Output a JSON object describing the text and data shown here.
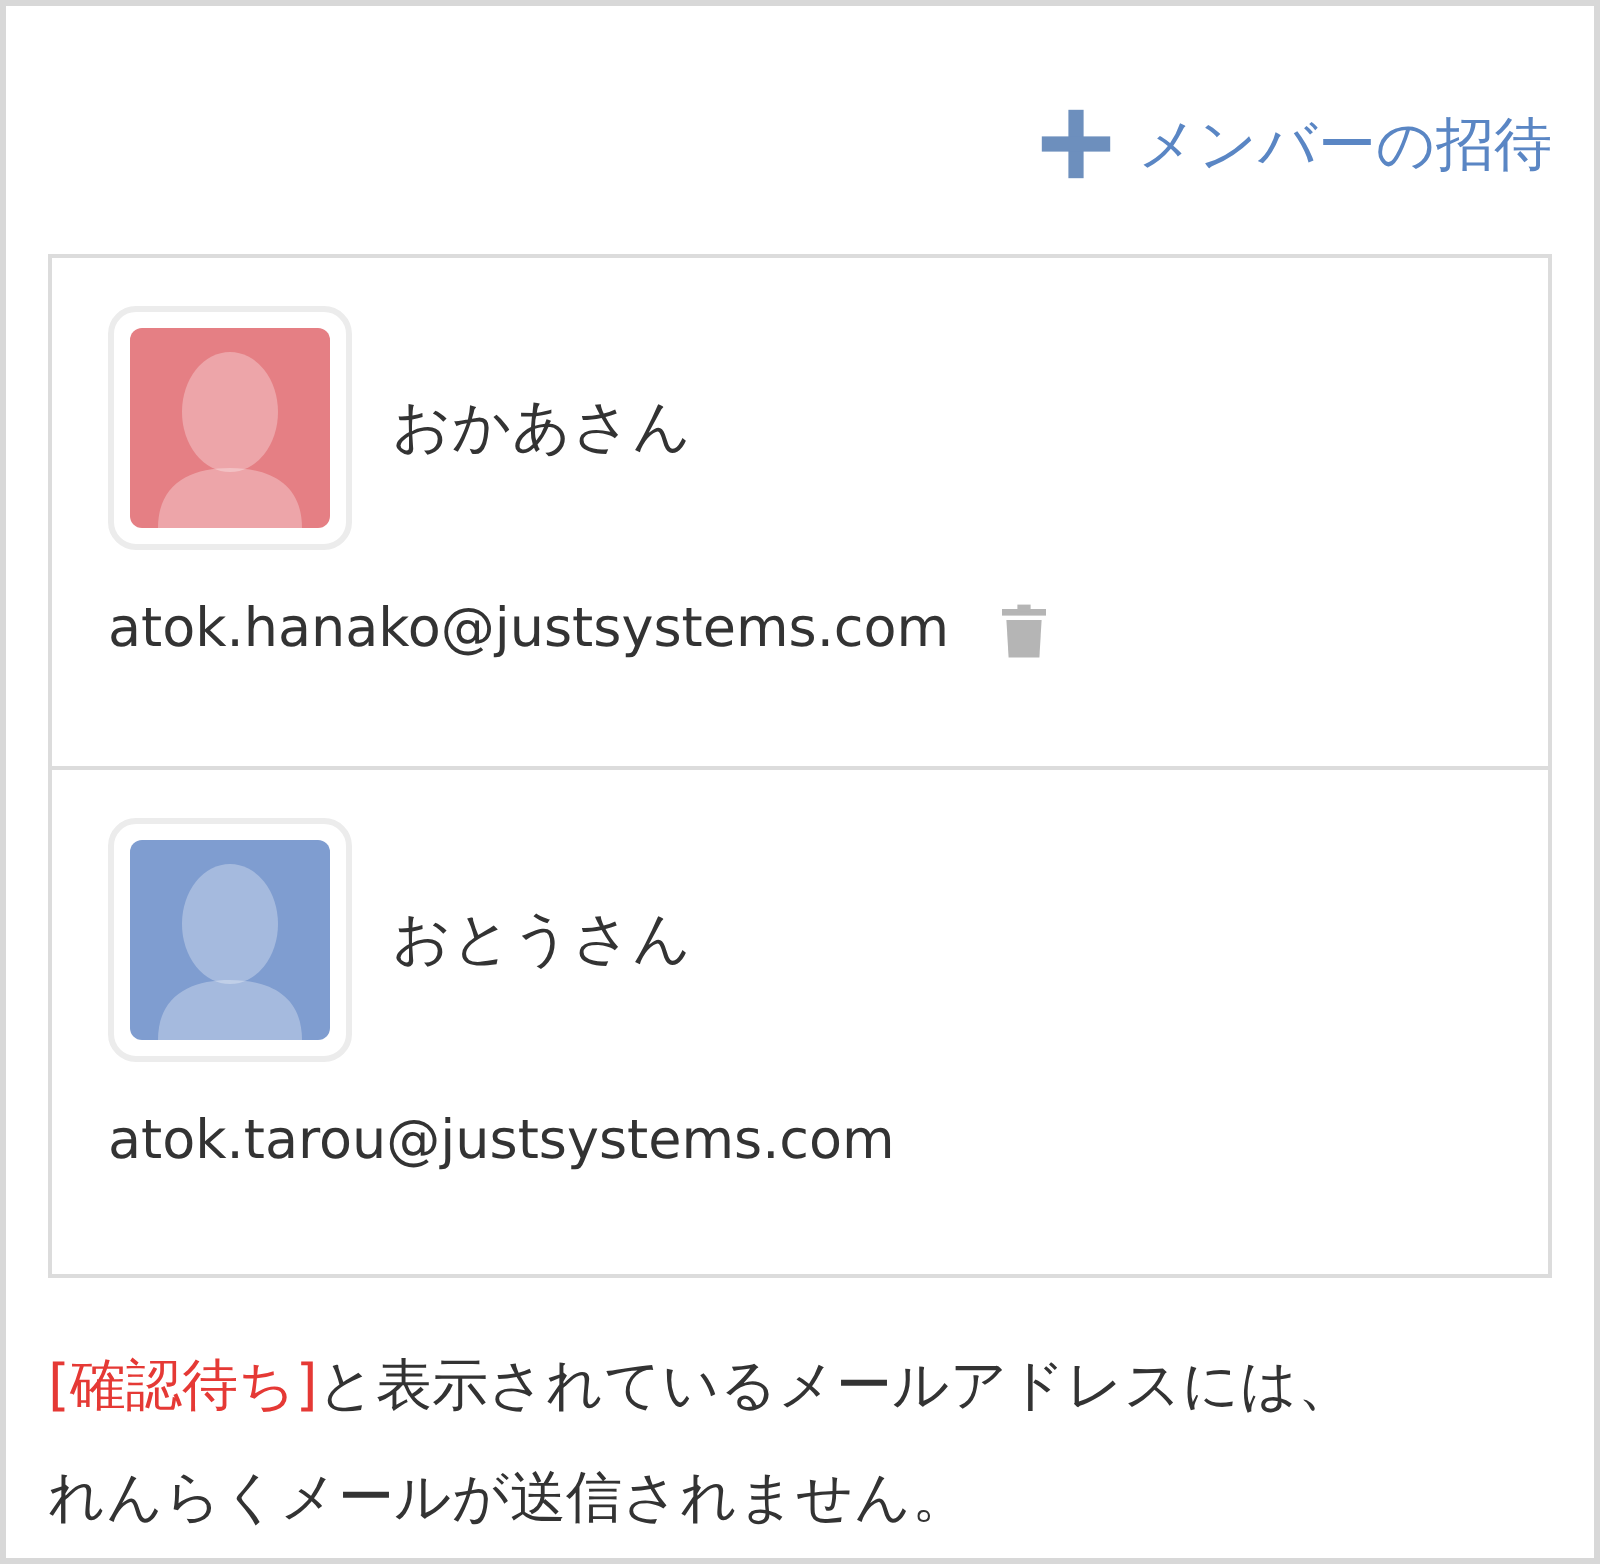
{
  "invite_link": {
    "label": "メンバーの招待"
  },
  "members": [
    {
      "name": "おかあさん",
      "email": "atok.hanako@justsystems.com",
      "color": "#e57f84",
      "deletable": true
    },
    {
      "name": "おとうさん",
      "email": "atok.tarou@justsystems.com",
      "color": "#7f9dd0",
      "deletable": false
    }
  ],
  "note": {
    "highlight": "[確認待ち]",
    "text": "と表示されているメールアドレスには、れんらくメールが送信されません。"
  }
}
